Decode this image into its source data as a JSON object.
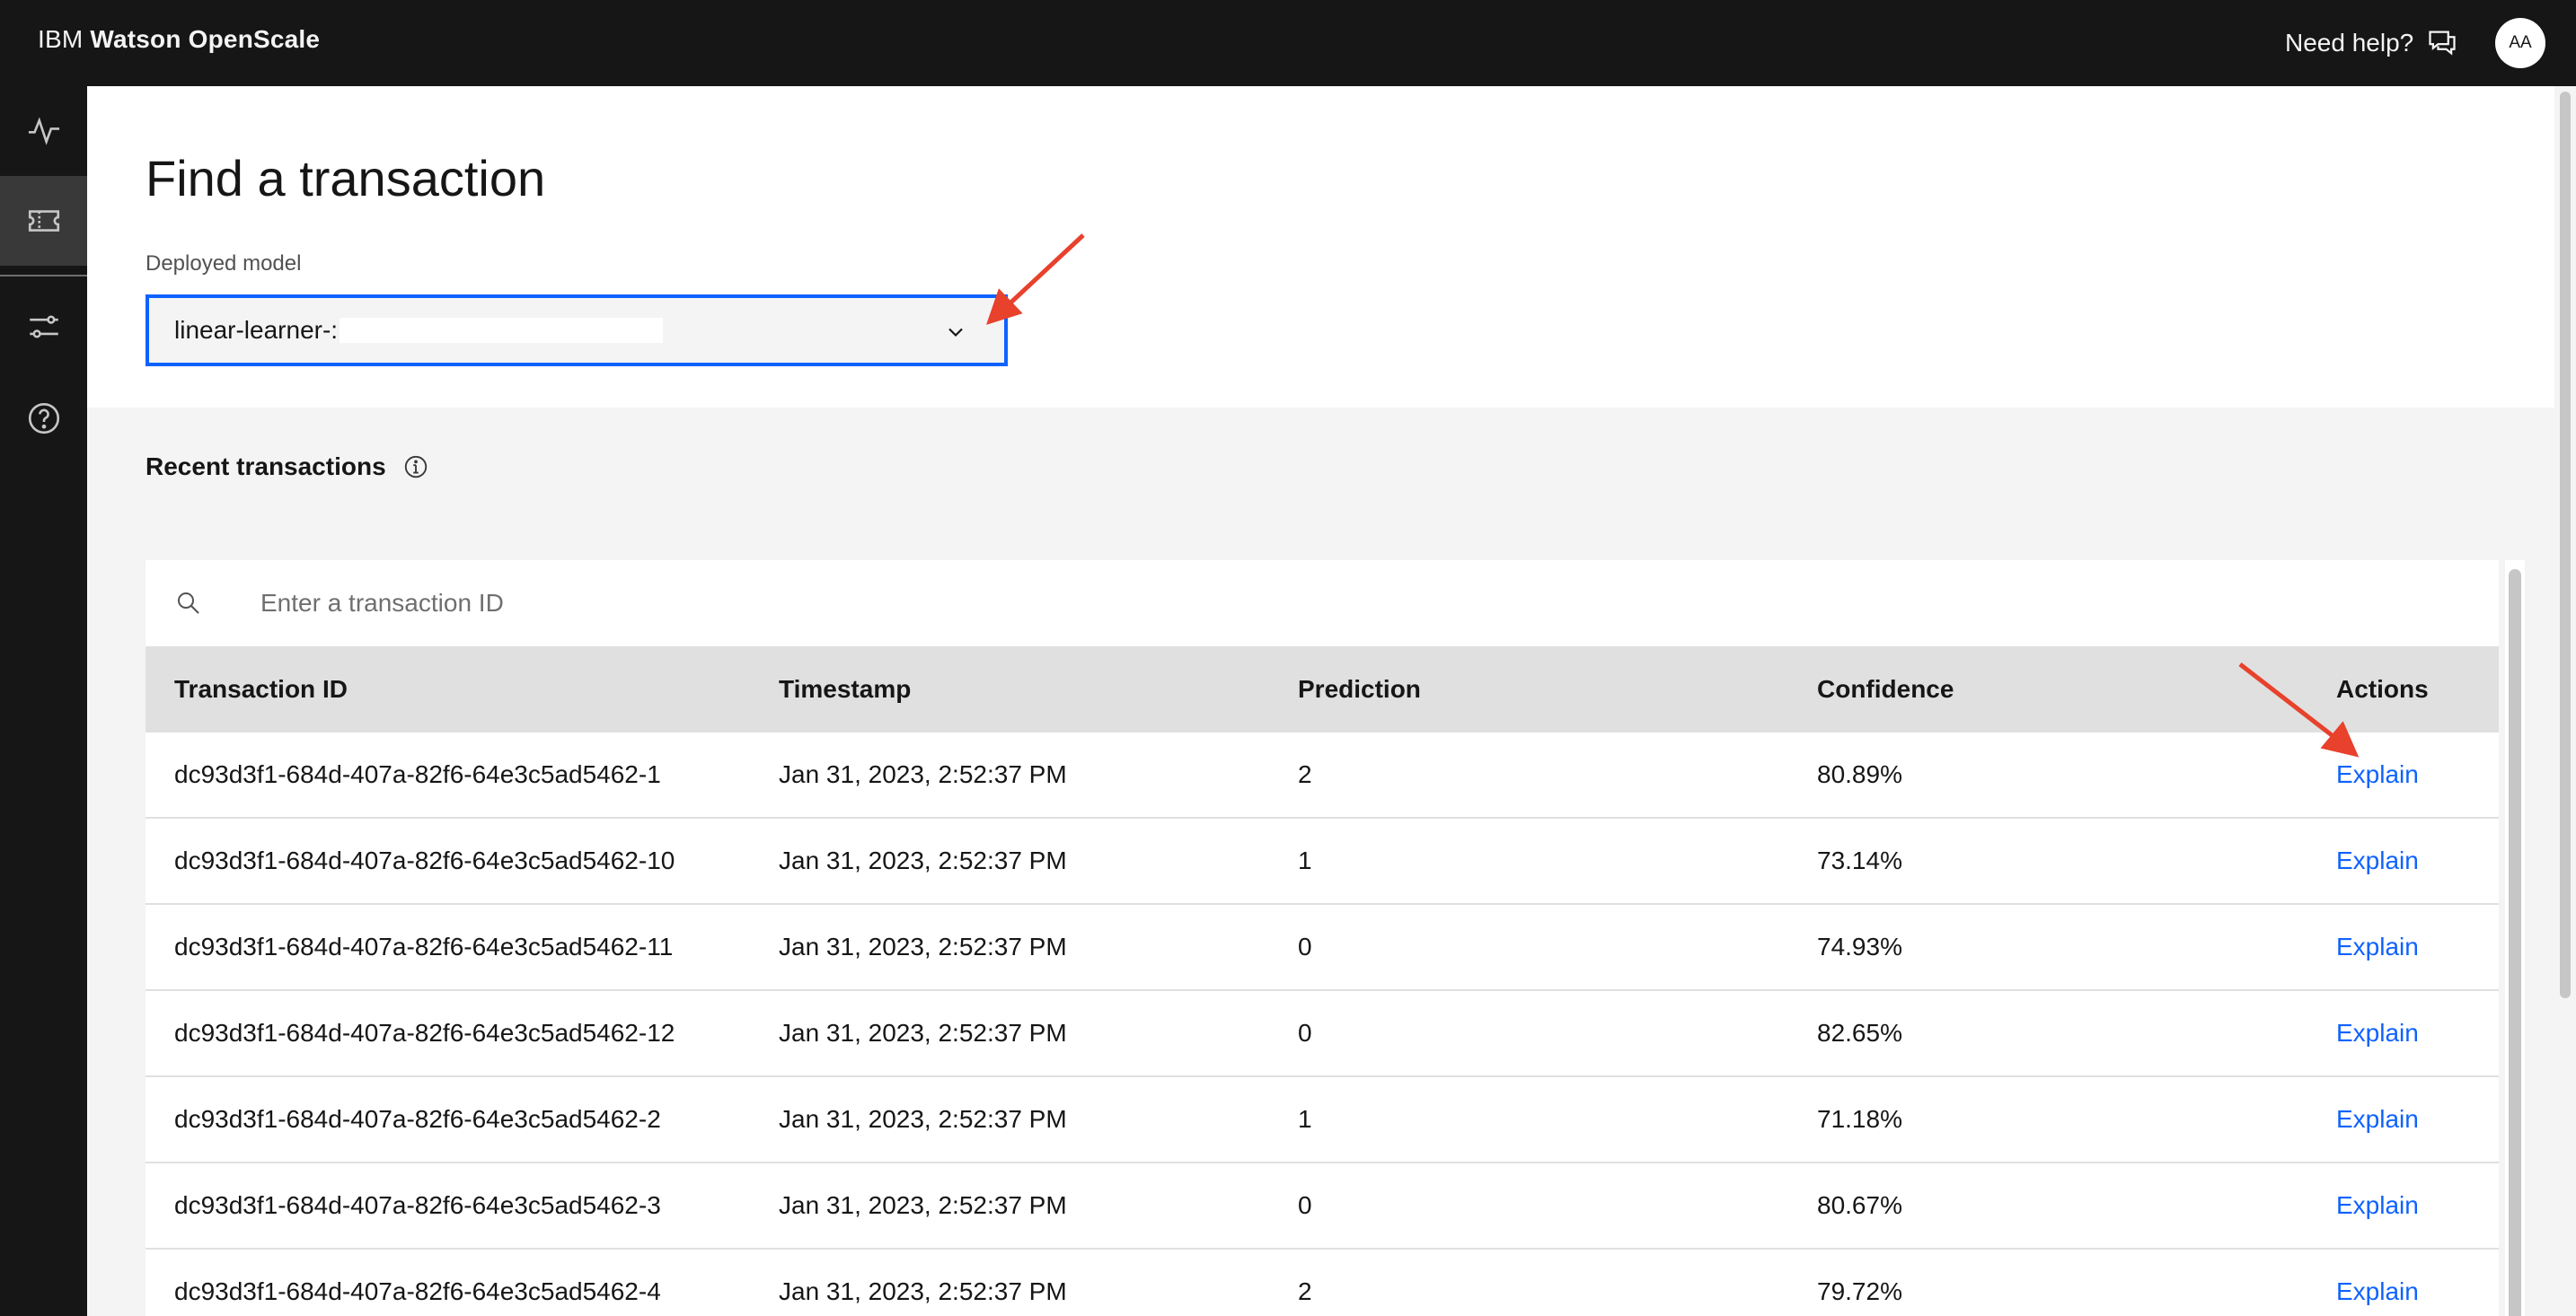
{
  "header": {
    "brand_prefix": "IBM",
    "brand_product": "Watson OpenScale",
    "help_label": "Need help?",
    "avatar_initials": "AA"
  },
  "sidenav": {
    "items": [
      {
        "icon": "activity-icon"
      },
      {
        "icon": "ticket-icon",
        "active": true
      },
      {
        "icon": "sliders-icon"
      },
      {
        "icon": "help-circle-icon"
      }
    ]
  },
  "page": {
    "title": "Find a transaction",
    "model_label": "Deployed model",
    "model_value": "linear-learner-:"
  },
  "recent": {
    "title": "Recent transactions",
    "search_placeholder": "Enter a transaction ID",
    "columns": [
      "Transaction ID",
      "Timestamp",
      "Prediction",
      "Confidence",
      "Actions"
    ],
    "rows": [
      {
        "id": "dc93d3f1-684d-407a-82f6-64e3c5ad5462-1",
        "timestamp": "Jan 31, 2023, 2:52:37 PM",
        "prediction": "2",
        "confidence": "80.89%",
        "action": "Explain"
      },
      {
        "id": "dc93d3f1-684d-407a-82f6-64e3c5ad5462-10",
        "timestamp": "Jan 31, 2023, 2:52:37 PM",
        "prediction": "1",
        "confidence": "73.14%",
        "action": "Explain"
      },
      {
        "id": "dc93d3f1-684d-407a-82f6-64e3c5ad5462-11",
        "timestamp": "Jan 31, 2023, 2:52:37 PM",
        "prediction": "0",
        "confidence": "74.93%",
        "action": "Explain"
      },
      {
        "id": "dc93d3f1-684d-407a-82f6-64e3c5ad5462-12",
        "timestamp": "Jan 31, 2023, 2:52:37 PM",
        "prediction": "0",
        "confidence": "82.65%",
        "action": "Explain"
      },
      {
        "id": "dc93d3f1-684d-407a-82f6-64e3c5ad5462-2",
        "timestamp": "Jan 31, 2023, 2:52:37 PM",
        "prediction": "1",
        "confidence": "71.18%",
        "action": "Explain"
      },
      {
        "id": "dc93d3f1-684d-407a-82f6-64e3c5ad5462-3",
        "timestamp": "Jan 31, 2023, 2:52:37 PM",
        "prediction": "0",
        "confidence": "80.67%",
        "action": "Explain"
      },
      {
        "id": "dc93d3f1-684d-407a-82f6-64e3c5ad5462-4",
        "timestamp": "Jan 31, 2023, 2:52:37 PM",
        "prediction": "2",
        "confidence": "79.72%",
        "action": "Explain"
      }
    ]
  },
  "colors": {
    "header_bg": "#161616",
    "accent": "#0f62fe",
    "annotation_arrow": "#e8412c"
  }
}
